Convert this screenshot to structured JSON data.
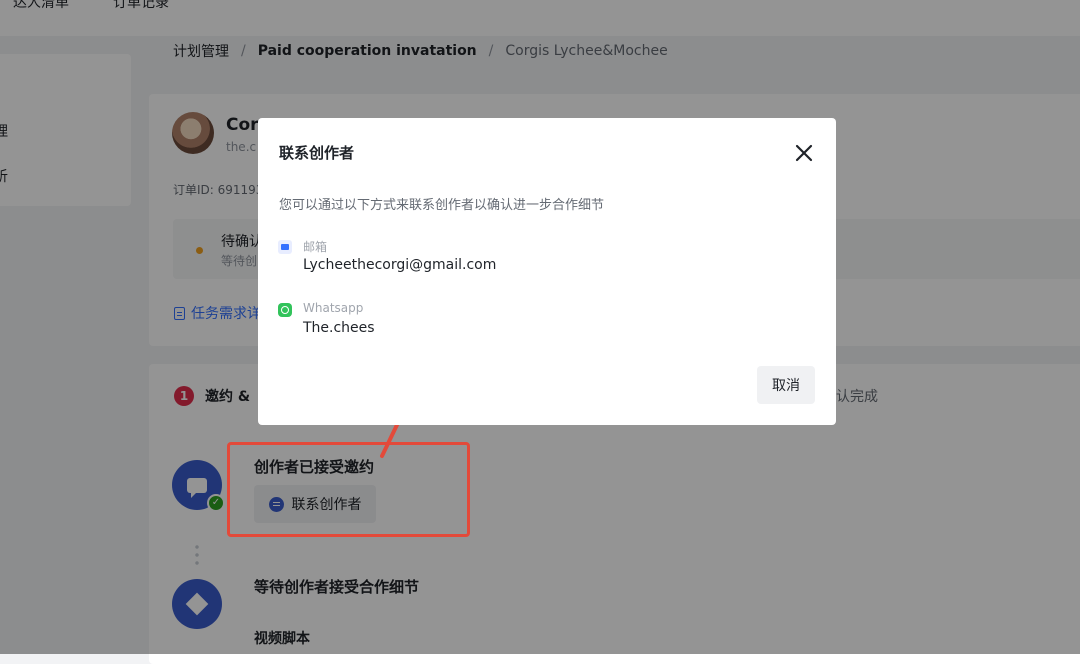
{
  "top_nav": {
    "tabs": [
      "达人清单",
      "订单记录"
    ]
  },
  "left_panel": {
    "items": [
      "理",
      "析"
    ]
  },
  "breadcrumb": {
    "items": [
      "计划管理",
      "Paid cooperation invatation",
      "Corgis Lychee&Mochee"
    ],
    "separator": "/"
  },
  "creator": {
    "name": "Corg",
    "handle": "the.c",
    "order_id": "订单ID: 691193"
  },
  "status": {
    "title": "待确认",
    "subtitle": "等待创"
  },
  "task_link": {
    "label": "任务需求详"
  },
  "steps": {
    "step1_number": "1",
    "step1_label": "邀约 &",
    "step3_label": "认完成"
  },
  "timeline": {
    "accepted_title": "创作者已接受邀约",
    "contact_button": "联系创作者",
    "waiting_title": "等待创作者接受合作细节",
    "video_script": "视频脚本"
  },
  "modal": {
    "title": "联系创作者",
    "description": "您可以通过以下方式来联系创作者以确认进一步合作细节",
    "contacts": [
      {
        "label": "邮箱",
        "value": "Lycheethecorgi@gmail.com",
        "icon": "mail-icon"
      },
      {
        "label": "Whatsapp",
        "value": "The.chees",
        "icon": "whatsapp-icon"
      }
    ],
    "cancel_label": "取消",
    "close_icon": "close-icon"
  },
  "colors": {
    "accent": "#3370ff",
    "timeline_icon": "#3a5ccc",
    "highlight": "#e34a3a",
    "step_badge": "#e22e4c",
    "success": "#2ea121"
  }
}
